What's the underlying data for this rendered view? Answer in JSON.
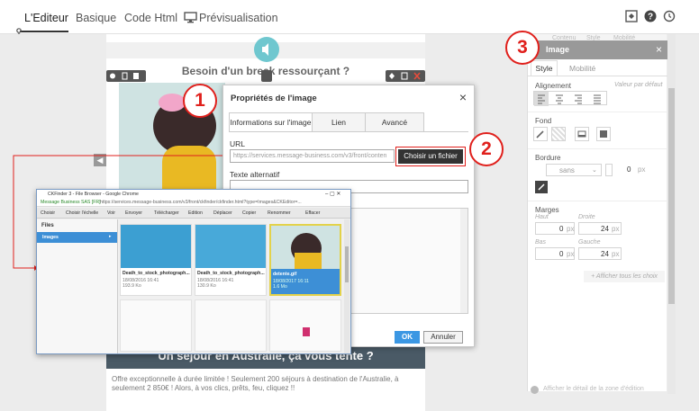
{
  "tabs": [
    {
      "label": "L'Editeur"
    },
    {
      "label": "Basique"
    },
    {
      "label": "Code Html"
    },
    {
      "label": "Prévisualisation"
    }
  ],
  "email": {
    "heading": "Besoin d'un break ressourçant ?",
    "banner": "Un séjour en Australie, ça vous tente ?",
    "body": "Offre exceptionnelle à durée limitée ! Seulement 200 séjours à destination de l'Australie, à seulement 2 850€ ! Alors, à vos clics, prêts, feu, cliquez !!"
  },
  "dialog": {
    "title": "Propriétés de l'image",
    "close": "×",
    "tabs": [
      "Informations sur l'image",
      "Lien",
      "Avancé"
    ],
    "url_label": "URL",
    "url_value": "https://services.message-business.com/v3/front/conten",
    "choose_button": "Choisir un fichier",
    "alt_label": "Texte alternatif",
    "ok": "OK",
    "cancel": "Annuler"
  },
  "filebrowser": {
    "title": "CKFinder 3 - File Browser - Google Chrome",
    "address_site": "Message Business SAS [FR]",
    "address_url": "https://services.message-business.com/v3/front/ckfinder/ckfinder.html?type=Images&CKEditor=...",
    "toolbar": [
      "Choisir",
      "Choisir l'échelle",
      "Voir",
      "Envoyer",
      "Télécharger",
      "Edition",
      "Déplacer",
      "Copier",
      "Renommer",
      "Effacer"
    ],
    "folders_header": "Files",
    "folder": "Images",
    "files": [
      {
        "name": "Death_to_stock_photograph...",
        "date": "18/08/2016 16:41",
        "size": "193.9 Ko"
      },
      {
        "name": "Death_to_stock_photograph...",
        "date": "18/08/2016 16:41",
        "size": "130.9 Ko"
      },
      {
        "name": "detente.gif",
        "date": "18/08/2017 16:11",
        "size": "1.6 Mo"
      }
    ]
  },
  "panel": {
    "header_tabs": [
      "Contenu",
      "Style",
      "Mobilité"
    ],
    "title": "Image",
    "close": "×",
    "tabs": [
      "Style",
      "Mobilité"
    ],
    "alignment_label": "Alignement",
    "default_value": "Valeur par défaut",
    "background_label": "Fond",
    "border_label": "Bordure",
    "border_style": "sans",
    "border_width": "0",
    "unit": "px",
    "margins_label": "Marges",
    "margin_top_label": "Haut",
    "margin_right_label": "Droite",
    "margin_bottom_label": "Bas",
    "margin_left_label": "Gauche",
    "margin_top": "0",
    "margin_right": "24",
    "margin_bottom": "0",
    "margin_left": "24",
    "show_all": "+ Afficher tous les choix",
    "footer": "Afficher le détail de la zone d'édition"
  },
  "callouts": [
    "1",
    "2",
    "3"
  ],
  "colors": {
    "accent": "#2e8bd8",
    "callout": "#e0201c",
    "primary_button": "#3b97e3"
  }
}
